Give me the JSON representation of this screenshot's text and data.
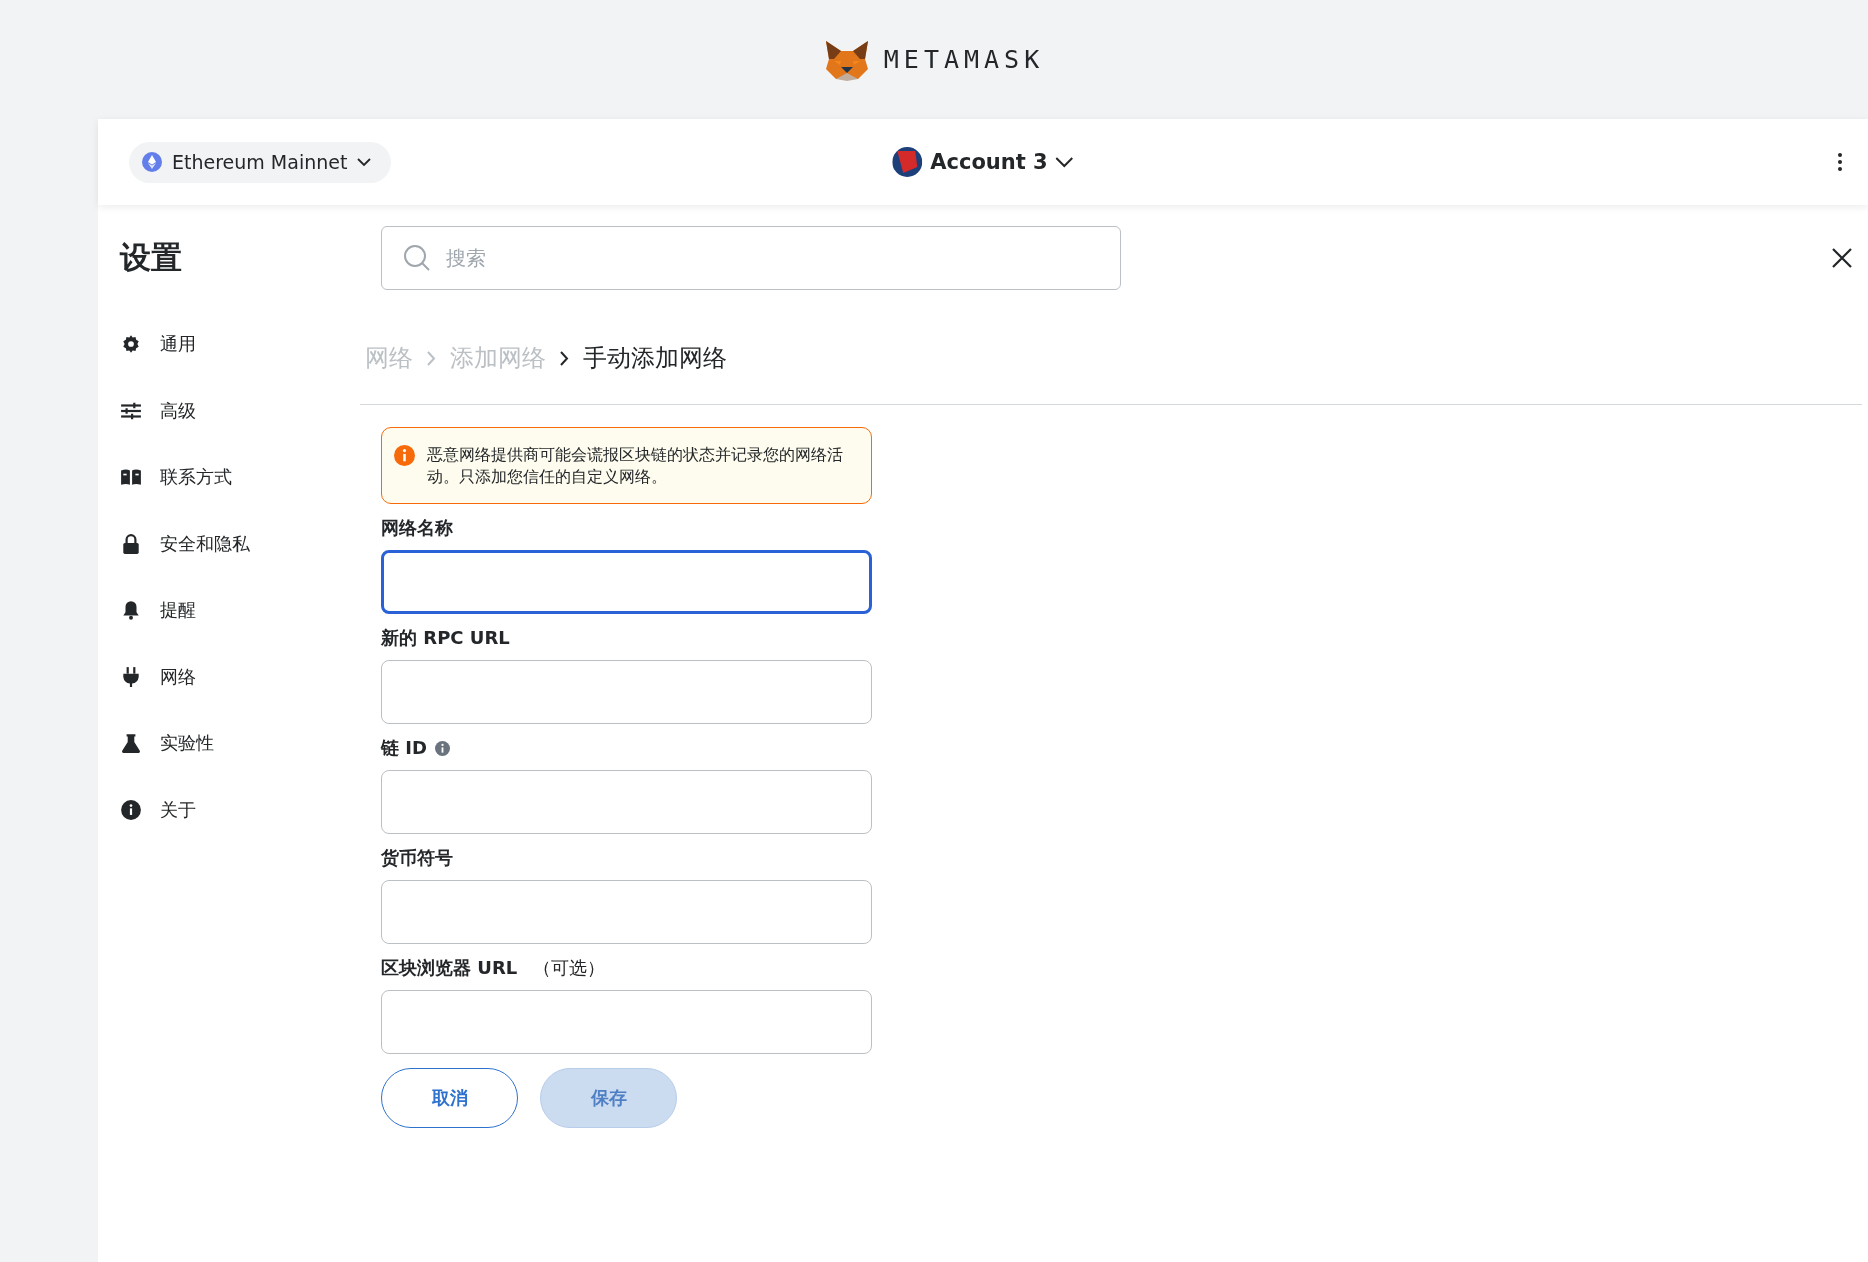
{
  "logo": {
    "wordmark": "METAMASK"
  },
  "header": {
    "network": "Ethereum Mainnet",
    "account": "Account 3"
  },
  "sidebar": {
    "title": "设置",
    "items": [
      {
        "kind": "gear",
        "label": "通用"
      },
      {
        "kind": "sliders",
        "label": "高级"
      },
      {
        "kind": "book",
        "label": "联系方式"
      },
      {
        "kind": "lock",
        "label": "安全和隐私"
      },
      {
        "kind": "bell",
        "label": "提醒"
      },
      {
        "kind": "plug",
        "label": "网络"
      },
      {
        "kind": "flask",
        "label": "实验性"
      },
      {
        "kind": "info",
        "label": "关于"
      }
    ]
  },
  "search": {
    "placeholder": "搜索"
  },
  "breadcrumb": [
    {
      "label": "网络",
      "current": false
    },
    {
      "label": "添加网络",
      "current": false
    },
    {
      "label": "手动添加网络",
      "current": true
    }
  ],
  "warning": "恶意网络提供商可能会谎报区块链的状态并记录您的网络活动。只添加您信任的自定义网络。",
  "form": {
    "fields": [
      {
        "label": "网络名称",
        "focused": true
      },
      {
        "label": "新的 RPC URL",
        "focused": false
      },
      {
        "label": "链 ID",
        "info": true,
        "focused": false
      },
      {
        "label": "货币符号",
        "focused": false
      },
      {
        "label": "区块浏览器 URL",
        "note": "（可选）",
        "focused": false
      }
    ],
    "buttons": [
      {
        "label": "取消",
        "kind": "secondary",
        "disabled": false
      },
      {
        "label": "保存",
        "kind": "primary",
        "disabled": true
      }
    ]
  }
}
